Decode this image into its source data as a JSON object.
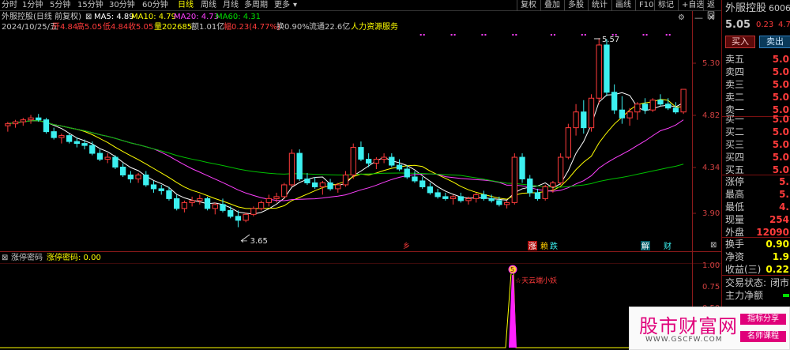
{
  "toolbar": {
    "periods": [
      "分时",
      "1分钟",
      "5分钟",
      "15分钟",
      "30分钟",
      "60分钟",
      "日线",
      "周线",
      "月线",
      "多周期",
      "更多"
    ],
    "active": "日线",
    "right_buttons": [
      "复权",
      "叠加",
      "多股",
      "统计",
      "画线",
      "F10",
      "标记",
      "+自选",
      "返回"
    ]
  },
  "header": {
    "title": "外服控股(日线 前复权)",
    "ma5": "MA5: 4.89",
    "ma10": "MA10: 4.79",
    "ma20": "MA20: 4.73",
    "ma60": "MA60: 4.31",
    "date": "2024/10/25/五",
    "open": "开4.84",
    "high": "高5.05",
    "low": "低4.84",
    "close": "收5.05",
    "volume": "量202685",
    "amount": "额1.01亿",
    "change": "幅0.23(4.77%)",
    "turnover": "换0.90%",
    "float": "流通22.6亿",
    "industry": "人力资源服务"
  },
  "y_axis": [
    "5.30",
    "4.82",
    "4.34",
    "3.90"
  ],
  "indicator_axis": [
    "1.00",
    "0.75",
    "0.50"
  ],
  "annotations": {
    "high": "5.57",
    "low": "3.65"
  },
  "markers": {
    "m1": "乡",
    "zhang": "涨",
    "m2": "赖",
    "die": "跌",
    "jie": "解",
    "cai": "财"
  },
  "indicator": {
    "name": "涨停密码",
    "label": "涨停密码: 0.00",
    "note": "天云端小妖",
    "icon": "5"
  },
  "right_panel": {
    "stock_name": "外服控股",
    "code": "6006",
    "price": "5.05",
    "chg": "0.23",
    "pct": "4.7",
    "buy_btn": "买入",
    "sell_btn": "卖出",
    "ask": [
      {
        "k": "卖五",
        "v": "5.0"
      },
      {
        "k": "卖四",
        "v": "5.0"
      },
      {
        "k": "卖三",
        "v": "5.0"
      },
      {
        "k": "卖二",
        "v": "5.0"
      },
      {
        "k": "卖一",
        "v": "5.0"
      }
    ],
    "bid": [
      {
        "k": "买一",
        "v": "5.0"
      },
      {
        "k": "买二",
        "v": "5.0"
      },
      {
        "k": "买三",
        "v": "5.0"
      },
      {
        "k": "买四",
        "v": "5.0"
      },
      {
        "k": "买五",
        "v": "5.0"
      }
    ],
    "stats": [
      {
        "k": "涨停",
        "v": "5."
      },
      {
        "k": "最高",
        "v": "5."
      },
      {
        "k": "最低",
        "v": "4."
      },
      {
        "k": "现量",
        "v": "254"
      },
      {
        "k": "外盘",
        "v": "12090"
      },
      {
        "k": "换手",
        "v": "0.90"
      },
      {
        "k": "净资",
        "v": "1.9"
      },
      {
        "k": "收益(三)",
        "v": "0.22"
      }
    ],
    "trade_status_label": "交易状态:",
    "trade_status": "闭市",
    "main_flow": "主力净额"
  },
  "watermark": {
    "title": "股市财富网",
    "url": "WWW.GSCFW.COM",
    "tag1": "指标分享",
    "tag2": "名师课程"
  },
  "chart_data": {
    "type": "candlestick",
    "ylim": [
      3.55,
      5.62
    ],
    "candles": [
      [
        4.68,
        4.72,
        4.62,
        4.7
      ],
      [
        4.7,
        4.74,
        4.66,
        4.72
      ],
      [
        4.72,
        4.76,
        4.68,
        4.74
      ],
      [
        4.74,
        4.79,
        4.7,
        4.76
      ],
      [
        4.76,
        4.8,
        4.72,
        4.74
      ],
      [
        4.74,
        4.76,
        4.6,
        4.62
      ],
      [
        4.62,
        4.66,
        4.54,
        4.56
      ],
      [
        4.56,
        4.6,
        4.5,
        4.58
      ],
      [
        4.58,
        4.6,
        4.5,
        4.52
      ],
      [
        4.52,
        4.56,
        4.46,
        4.5
      ],
      [
        4.5,
        4.54,
        4.44,
        4.48
      ],
      [
        4.48,
        4.52,
        4.38,
        4.4
      ],
      [
        4.4,
        4.44,
        4.32,
        4.34
      ],
      [
        4.34,
        4.4,
        4.3,
        4.36
      ],
      [
        4.36,
        4.38,
        4.24,
        4.26
      ],
      [
        4.26,
        4.3,
        4.16,
        4.18
      ],
      [
        4.18,
        4.22,
        4.1,
        4.14
      ],
      [
        4.14,
        4.2,
        4.1,
        4.18
      ],
      [
        4.18,
        4.22,
        4.06,
        4.08
      ],
      [
        4.08,
        4.12,
        4.0,
        4.04
      ],
      [
        4.04,
        4.08,
        3.98,
        4.02
      ],
      [
        4.02,
        4.06,
        3.92,
        3.94
      ],
      [
        3.94,
        3.98,
        3.82,
        3.84
      ],
      [
        3.84,
        3.92,
        3.8,
        3.9
      ],
      [
        3.9,
        3.96,
        3.86,
        3.92
      ],
      [
        3.92,
        3.98,
        3.88,
        3.94
      ],
      [
        3.94,
        3.96,
        3.82,
        3.84
      ],
      [
        3.84,
        3.9,
        3.78,
        3.88
      ],
      [
        3.88,
        3.94,
        3.8,
        3.82
      ],
      [
        3.82,
        3.86,
        3.74,
        3.76
      ],
      [
        3.76,
        3.82,
        3.65,
        3.72
      ],
      [
        3.72,
        3.8,
        3.7,
        3.78
      ],
      [
        3.78,
        3.86,
        3.76,
        3.84
      ],
      [
        3.84,
        3.92,
        3.82,
        3.9
      ],
      [
        3.9,
        3.98,
        3.86,
        3.94
      ],
      [
        3.94,
        4.0,
        3.9,
        3.96
      ],
      [
        3.96,
        4.1,
        3.94,
        4.08
      ],
      [
        4.08,
        4.44,
        4.06,
        4.4
      ],
      [
        4.4,
        4.44,
        4.12,
        4.14
      ],
      [
        4.14,
        4.2,
        4.08,
        4.1
      ],
      [
        4.1,
        4.16,
        4.04,
        4.06
      ],
      [
        4.06,
        4.12,
        3.98,
        4.1
      ],
      [
        4.1,
        4.14,
        4.02,
        4.04
      ],
      [
        4.04,
        4.1,
        4.0,
        4.08
      ],
      [
        4.08,
        4.22,
        4.06,
        4.18
      ],
      [
        4.18,
        4.5,
        4.14,
        4.46
      ],
      [
        4.46,
        4.52,
        4.32,
        4.34
      ],
      [
        4.34,
        4.4,
        4.26,
        4.3
      ],
      [
        4.3,
        4.36,
        4.24,
        4.34
      ],
      [
        4.34,
        4.4,
        4.3,
        4.36
      ],
      [
        4.36,
        4.4,
        4.26,
        4.28
      ],
      [
        4.28,
        4.34,
        4.22,
        4.24
      ],
      [
        4.24,
        4.28,
        4.14,
        4.16
      ],
      [
        4.16,
        4.22,
        4.1,
        4.12
      ],
      [
        4.12,
        4.16,
        4.04,
        4.06
      ],
      [
        4.06,
        4.1,
        3.98,
        4.0
      ],
      [
        4.0,
        4.04,
        3.94,
        3.96
      ],
      [
        3.96,
        4.0,
        3.92,
        3.94
      ],
      [
        3.94,
        3.98,
        3.88,
        3.96
      ],
      [
        3.96,
        4.0,
        3.9,
        3.92
      ],
      [
        3.92,
        3.96,
        3.88,
        3.94
      ],
      [
        3.94,
        4.0,
        3.9,
        3.98
      ],
      [
        3.98,
        4.02,
        3.92,
        3.94
      ],
      [
        3.94,
        3.98,
        3.9,
        3.92
      ],
      [
        3.92,
        3.96,
        3.86,
        3.88
      ],
      [
        3.88,
        3.92,
        3.84,
        3.9
      ],
      [
        3.9,
        4.4,
        3.88,
        4.36
      ],
      [
        4.36,
        4.4,
        4.1,
        4.14
      ],
      [
        4.14,
        4.18,
        3.96,
        4.0
      ],
      [
        4.0,
        4.04,
        3.92,
        3.94
      ],
      [
        3.94,
        4.08,
        3.92,
        4.06
      ],
      [
        4.06,
        4.12,
        4.0,
        4.1
      ],
      [
        4.1,
        4.4,
        4.08,
        4.36
      ],
      [
        4.36,
        4.7,
        4.34,
        4.66
      ],
      [
        4.66,
        4.9,
        4.58,
        4.82
      ],
      [
        4.82,
        4.94,
        4.6,
        4.66
      ],
      [
        4.66,
        5.0,
        4.62,
        4.96
      ],
      [
        4.96,
        5.57,
        4.9,
        5.5
      ],
      [
        5.5,
        5.56,
        4.98,
        5.02
      ],
      [
        5.02,
        5.1,
        4.8,
        4.84
      ],
      [
        4.84,
        4.98,
        4.7,
        4.76
      ],
      [
        4.76,
        4.86,
        4.68,
        4.82
      ],
      [
        4.82,
        4.92,
        4.74,
        4.9
      ],
      [
        4.9,
        4.96,
        4.8,
        4.84
      ],
      [
        4.84,
        4.96,
        4.82,
        4.94
      ],
      [
        4.94,
        5.0,
        4.88,
        4.9
      ],
      [
        4.9,
        4.96,
        4.84,
        4.86
      ],
      [
        4.86,
        4.92,
        4.8,
        4.82
      ],
      [
        4.82,
        5.05,
        4.8,
        5.05
      ]
    ]
  }
}
